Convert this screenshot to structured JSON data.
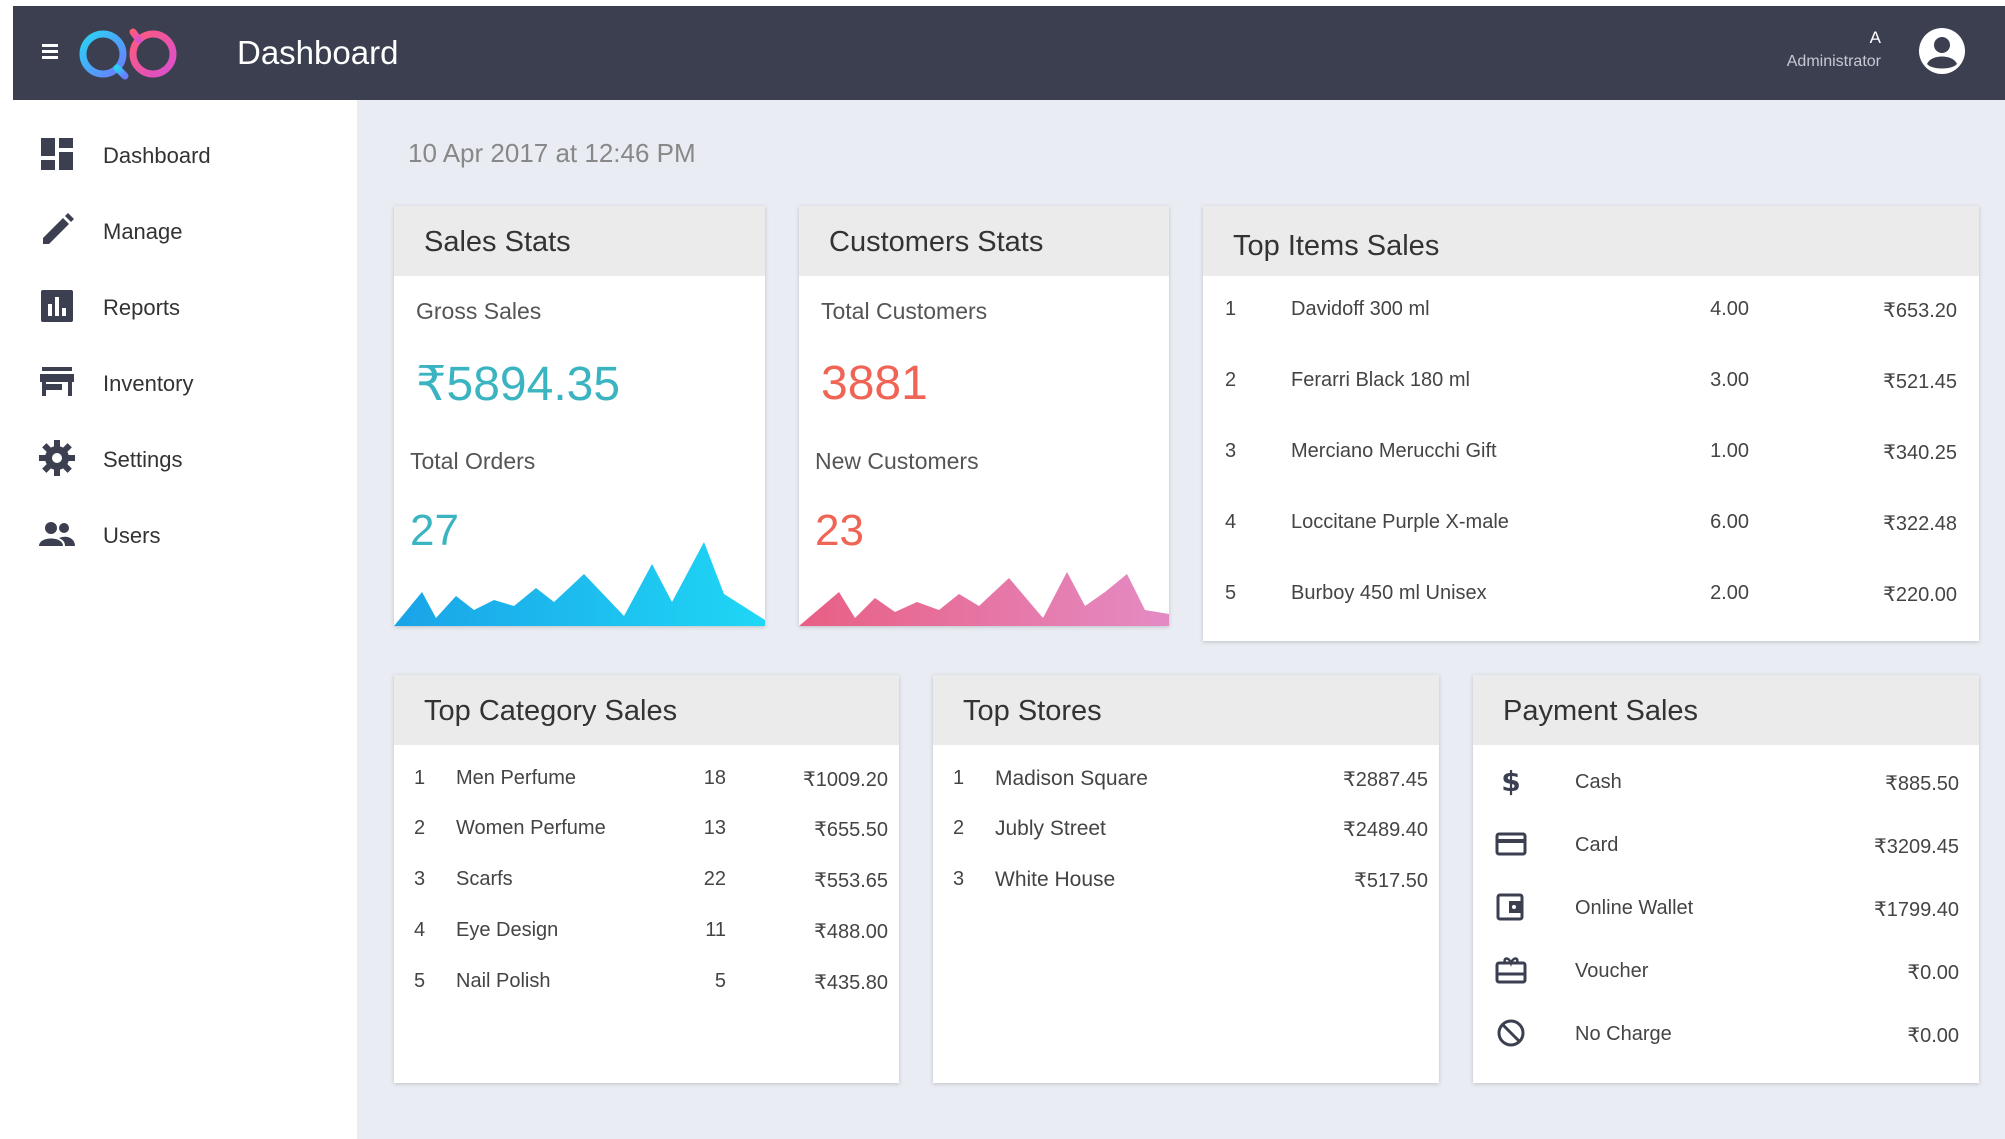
{
  "app": {
    "title": "Dashboard"
  },
  "user": {
    "initial": "A",
    "role": "Administrator"
  },
  "sidebar": {
    "items": [
      {
        "label": "Dashboard",
        "icon": "dashboard-icon"
      },
      {
        "label": "Manage",
        "icon": "pencil-icon"
      },
      {
        "label": "Reports",
        "icon": "bar-chart-icon"
      },
      {
        "label": "Inventory",
        "icon": "store-icon"
      },
      {
        "label": "Settings",
        "icon": "gear-icon"
      },
      {
        "label": "Users",
        "icon": "people-icon"
      }
    ]
  },
  "datetime": "10 Apr 2017 at 12:46 PM",
  "sales_stats": {
    "title": "Sales Stats",
    "gross_label": "Gross Sales",
    "gross_value": "₹5894.35",
    "orders_label": "Total Orders",
    "orders_value": "27",
    "color": "#3ab4c0"
  },
  "customer_stats": {
    "title": "Customers Stats",
    "total_label": "Total Customers",
    "total_value": "3881",
    "new_label": "New Customers",
    "new_value": "23",
    "color": "#ef6454"
  },
  "top_items": {
    "title": "Top Items Sales",
    "rows": [
      {
        "rank": "1",
        "name": "Davidoff 300 ml",
        "qty": "4.00",
        "amount": "₹653.20"
      },
      {
        "rank": "2",
        "name": "Ferarri Black 180 ml",
        "qty": "3.00",
        "amount": "₹521.45"
      },
      {
        "rank": "3",
        "name": "Merciano Merucchi Gift",
        "qty": "1.00",
        "amount": "₹340.25"
      },
      {
        "rank": "4",
        "name": "Loccitane Purple X-male",
        "qty": "6.00",
        "amount": "₹322.48"
      },
      {
        "rank": "5",
        "name": "Burboy 450 ml Unisex",
        "qty": "2.00",
        "amount": "₹220.00"
      }
    ]
  },
  "top_category": {
    "title": "Top Category Sales",
    "rows": [
      {
        "rank": "1",
        "name": "Men Perfume",
        "qty": "18",
        "amount": "₹1009.20"
      },
      {
        "rank": "2",
        "name": "Women Perfume",
        "qty": "13",
        "amount": "₹655.50"
      },
      {
        "rank": "3",
        "name": "Scarfs",
        "qty": "22",
        "amount": "₹553.65"
      },
      {
        "rank": "4",
        "name": "Eye Design",
        "qty": "11",
        "amount": "₹488.00"
      },
      {
        "rank": "5",
        "name": "Nail Polish",
        "qty": "5",
        "amount": "₹435.80"
      }
    ]
  },
  "top_stores": {
    "title": "Top Stores",
    "rows": [
      {
        "rank": "1",
        "name": "Madison Square",
        "amount": "₹2887.45"
      },
      {
        "rank": "2",
        "name": "Jubly Street",
        "amount": "₹2489.40"
      },
      {
        "rank": "3",
        "name": "White House",
        "amount": "₹517.50"
      }
    ]
  },
  "payment_sales": {
    "title": "Payment Sales",
    "rows": [
      {
        "icon": "dollar-icon",
        "name": "Cash",
        "amount": "₹885.50"
      },
      {
        "icon": "credit-card-icon",
        "name": "Card",
        "amount": "₹3209.45"
      },
      {
        "icon": "wallet-icon",
        "name": "Online Wallet",
        "amount": "₹1799.40"
      },
      {
        "icon": "voucher-icon",
        "name": "Voucher",
        "amount": "₹0.00"
      },
      {
        "icon": "no-charge-icon",
        "name": "No Charge",
        "amount": "₹0.00"
      }
    ]
  }
}
